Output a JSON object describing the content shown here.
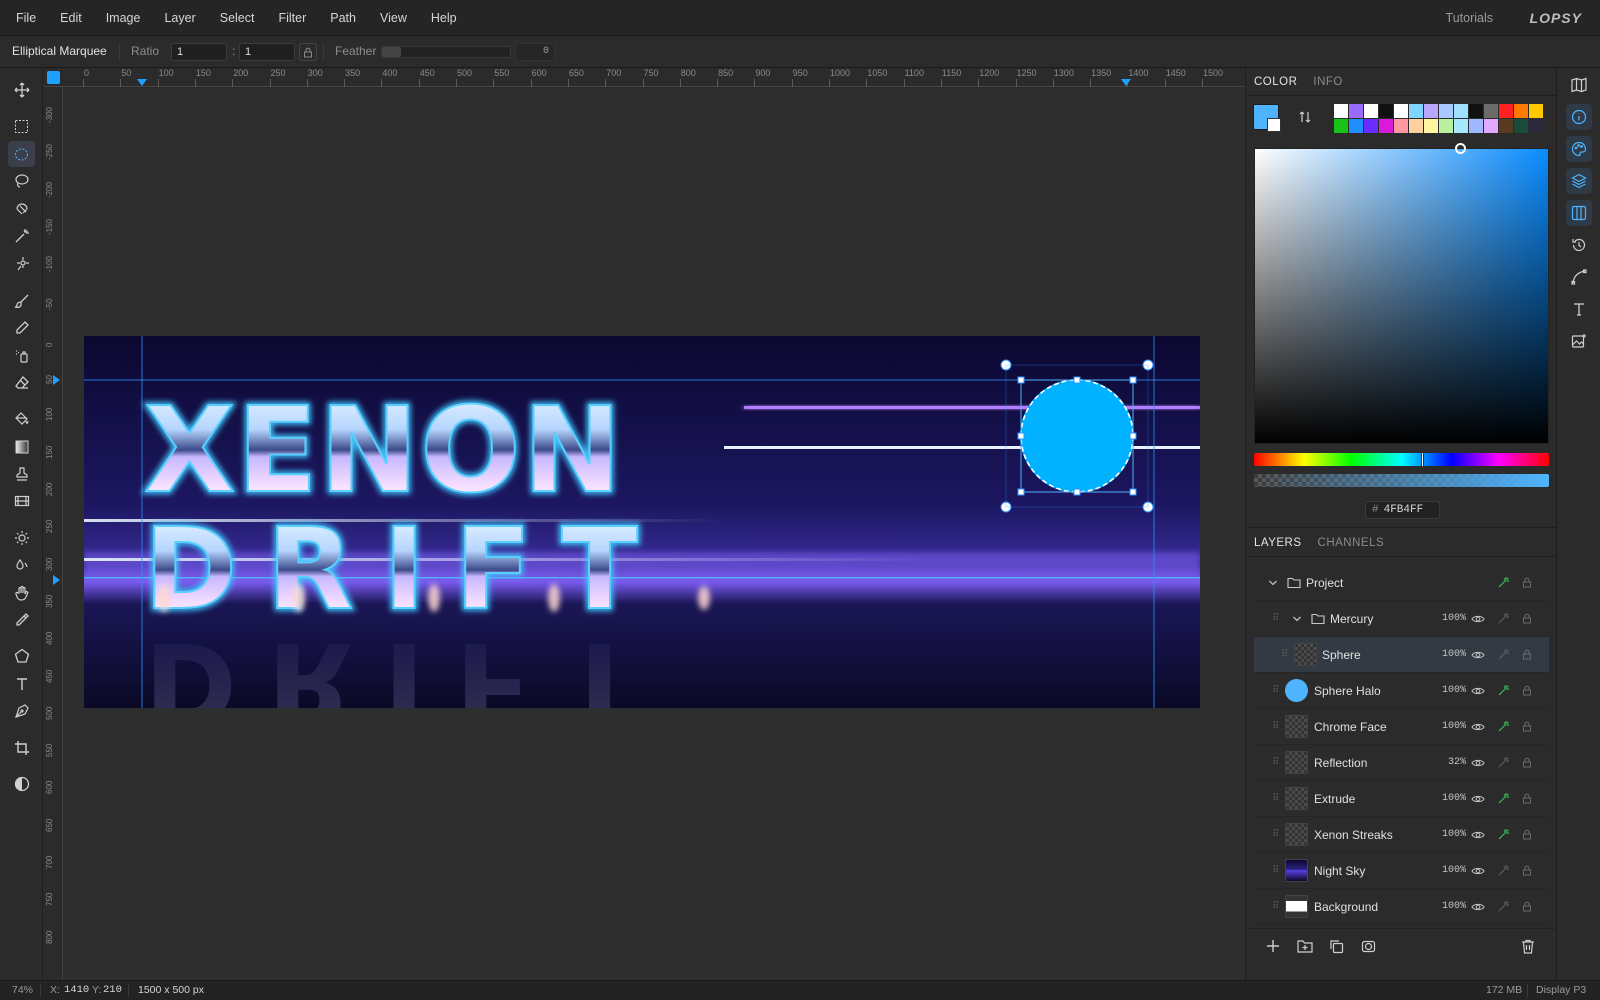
{
  "menubar": {
    "items": [
      "File",
      "Edit",
      "Image",
      "Layer",
      "Select",
      "Filter",
      "Path",
      "View",
      "Help"
    ],
    "tutorials": "Tutorials",
    "brand": "LOPSY"
  },
  "options": {
    "tool_name": "Elliptical Marquee",
    "ratio_label": "Ratio",
    "ratio_w": "1",
    "ratio_sep": ":",
    "ratio_h": "1",
    "feather_label": "Feather",
    "feather_value": "0"
  },
  "rulers": {
    "top": [
      "0",
      "50",
      "100",
      "150",
      "200",
      "250",
      "300",
      "350",
      "400",
      "450",
      "500",
      "550",
      "600",
      "650",
      "700",
      "750",
      "800",
      "850",
      "900",
      "950",
      "1000",
      "1050",
      "1100",
      "1150",
      "1200",
      "1250",
      "1300",
      "1350",
      "1400",
      "1450",
      "1500"
    ],
    "left": [
      "-300",
      "-250",
      "-200",
      "-150",
      "-100",
      "-50",
      "0",
      "50",
      "100",
      "150",
      "200",
      "250",
      "300",
      "350",
      "400",
      "450",
      "500",
      "550",
      "600",
      "650",
      "700",
      "750",
      "800"
    ]
  },
  "canvas": {
    "line1": "XENON",
    "line2": "DRIFT",
    "sphere_color": "#00b2ff"
  },
  "color_panel": {
    "tabs": [
      "COLOR",
      "INFO"
    ],
    "foreground": "#4fb4ff",
    "background": "#ffffff",
    "hex_prefix": "#",
    "hex": "4FB4FF",
    "palette_row1": [
      "#ffffff",
      "#9a6bff",
      "#ffffff",
      "#111111",
      "#ffffff",
      "#7fd4ff",
      "#b9a6ff",
      "#a8c8ff",
      "#9fe0ff",
      "#111111",
      "#6b6b6b",
      "#ff2020",
      "#ff7a00",
      "#ffc800"
    ],
    "palette_row2": [
      "#19c219",
      "#1f8fff",
      "#6a2cff",
      "#d81bd8",
      "#ff9aa2",
      "#ffd0a0",
      "#fff4a0",
      "#b8f0a0",
      "#a8e8ff",
      "#a0b8ff",
      "#e0a8ff",
      "#5a3a20",
      "#1a4a3a",
      "#2a2a3a"
    ]
  },
  "layers_panel": {
    "tabs": [
      "LAYERS",
      "CHANNELS"
    ],
    "layers": [
      {
        "name": "Project",
        "opacity": "",
        "kind": "group"
      },
      {
        "name": "Mercury",
        "opacity": "100%",
        "kind": "group"
      },
      {
        "name": "Sphere",
        "opacity": "100%",
        "kind": "layer"
      },
      {
        "name": "Sphere Halo",
        "opacity": "100%",
        "kind": "layer"
      },
      {
        "name": "Chrome Face",
        "opacity": "100%",
        "kind": "layer"
      },
      {
        "name": "Reflection",
        "opacity": "32%",
        "kind": "layer"
      },
      {
        "name": "Extrude",
        "opacity": "100%",
        "kind": "layer"
      },
      {
        "name": "Xenon Streaks",
        "opacity": "100%",
        "kind": "layer"
      },
      {
        "name": "Night Sky",
        "opacity": "100%",
        "kind": "layer"
      },
      {
        "name": "Background",
        "opacity": "100%",
        "kind": "layer"
      }
    ],
    "selected": "Sphere"
  },
  "status": {
    "zoom": "74%",
    "x_label": "X:",
    "x": "1410",
    "y_label": "Y:",
    "y": "210",
    "doc_size": "1500 x 500 px",
    "memory": "172 MB",
    "profile": "Display P3"
  },
  "colors": {
    "accent": "#1ea0ff",
    "panel": "#2b2b2b",
    "selected_row": "#343a44"
  }
}
